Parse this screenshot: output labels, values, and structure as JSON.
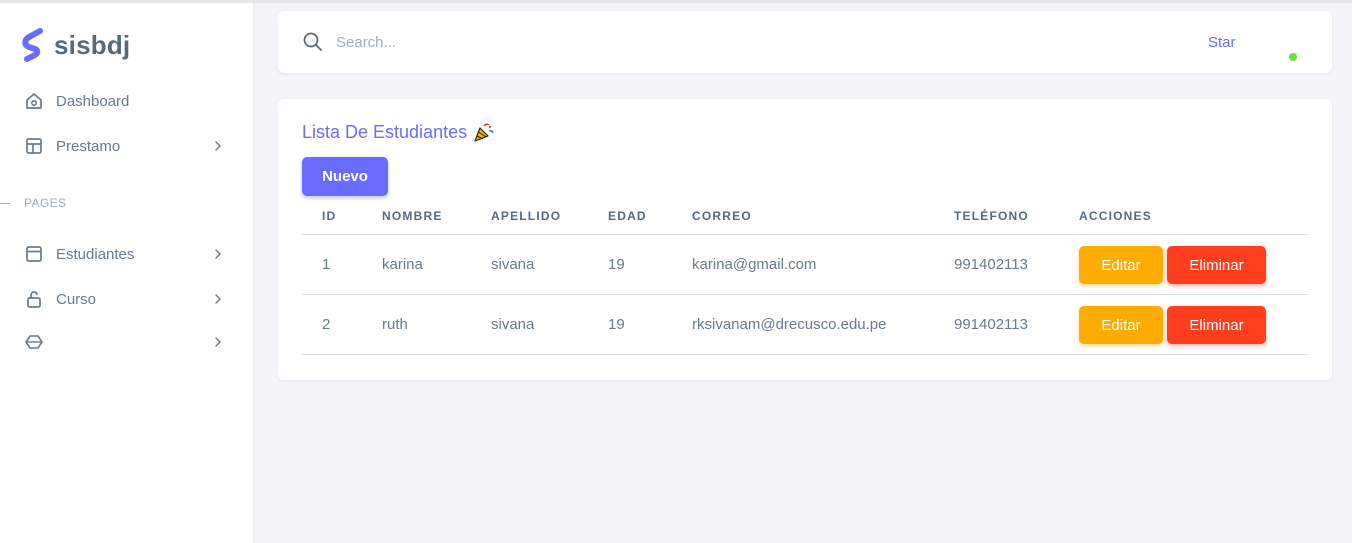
{
  "brand": {
    "name": "sisbdj",
    "accent": "#696cff"
  },
  "sidebar": {
    "items": [
      {
        "label": "Dashboard",
        "icon": "home-icon",
        "has_chevron": false
      },
      {
        "label": "Prestamo",
        "icon": "layout-icon",
        "has_chevron": true
      }
    ],
    "section_header": "PAGES",
    "page_items": [
      {
        "label": "Estudiantes",
        "icon": "window-icon",
        "has_chevron": true
      },
      {
        "label": "Curso",
        "icon": "lock-icon",
        "has_chevron": true
      },
      {
        "label": "",
        "icon": "cube-icon",
        "has_chevron": true
      }
    ]
  },
  "navbar": {
    "search_placeholder": "Search...",
    "star_label": "Star",
    "status_color": "#71dd37"
  },
  "card": {
    "title": "Lista De Estudiantes",
    "title_icon": "party-popper-icon",
    "new_button": "Nuevo",
    "columns": [
      "ID",
      "NOMBRE",
      "APELLIDO",
      "EDAD",
      "CORREO",
      "TELÉFONO",
      "ACCIONES"
    ],
    "rows": [
      {
        "id": "1",
        "nombre": "karina",
        "apellido": "sivana",
        "edad": "19",
        "correo": "karina@gmail.com",
        "telefono": "991402113"
      },
      {
        "id": "2",
        "nombre": "ruth",
        "apellido": "sivana",
        "edad": "19",
        "correo": "rksivanam@drecusco.edu.pe",
        "telefono": "991402113"
      }
    ],
    "edit_label": "Editar",
    "delete_label": "Eliminar",
    "colors": {
      "edit": "#ffab00",
      "delete": "#ff3e1d",
      "primary": "#696cff"
    }
  }
}
